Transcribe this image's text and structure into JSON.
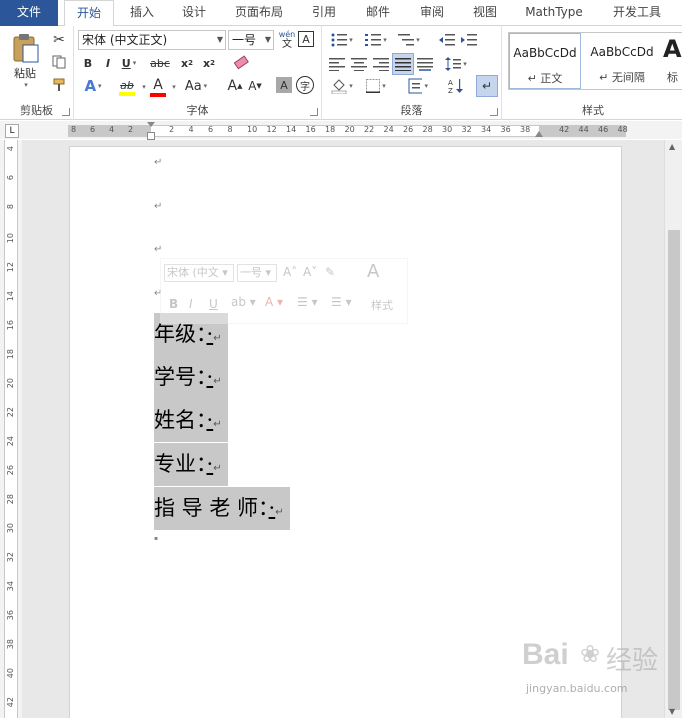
{
  "tabs": [
    {
      "label": "文件",
      "active": false
    },
    {
      "label": "开始",
      "active": true
    },
    {
      "label": "插入",
      "active": false
    },
    {
      "label": "设计",
      "active": false
    },
    {
      "label": "页面布局",
      "active": false
    },
    {
      "label": "引用",
      "active": false
    },
    {
      "label": "邮件",
      "active": false
    },
    {
      "label": "审阅",
      "active": false
    },
    {
      "label": "视图",
      "active": false
    },
    {
      "label": "MathType",
      "active": false
    },
    {
      "label": "开发工具",
      "active": false
    }
  ],
  "clipboard": {
    "label": "剪贴板",
    "paste_label": "粘贴"
  },
  "font": {
    "label": "字体",
    "font_name": "宋体 (中文正文)",
    "font_size": "一号",
    "phonetic_top": "wén",
    "phonetic_bottom": "文",
    "border_char": "A",
    "bold": "B",
    "italic": "I",
    "underline": "U",
    "strike": "abc",
    "subscript": "x",
    "subscript_mark": "2",
    "superscript": "x",
    "superscript_mark": "2",
    "grow": "A",
    "shrink": "A",
    "case": "Aa",
    "shading_char": "A",
    "enclose_char": "字",
    "text_effect": "A",
    "highlight": "ab",
    "font_color": "A"
  },
  "paragraph": {
    "label": "段落"
  },
  "styles": {
    "label": "样式",
    "items": [
      {
        "preview": "AaBbCcDd",
        "name": "正文"
      },
      {
        "preview": "AaBbCcDd",
        "name": "无间隔"
      },
      {
        "preview": "Aa",
        "name": "标"
      }
    ]
  },
  "ruler": {
    "h_ticks_left": [
      "8",
      "6",
      "4",
      "2"
    ],
    "h_ticks_right": [
      "2",
      "4",
      "6",
      "8",
      "10",
      "12",
      "14",
      "16",
      "18",
      "20",
      "22",
      "24",
      "26",
      "28",
      "30",
      "32",
      "34",
      "36",
      "38",
      "42",
      "44",
      "46",
      "48"
    ],
    "v_ticks": [
      "4",
      "6",
      "8",
      "10",
      "12",
      "14",
      "16",
      "18",
      "20",
      "22",
      "24",
      "26",
      "28",
      "30",
      "32",
      "34",
      "36",
      "38",
      "40",
      "42"
    ]
  },
  "document": {
    "lines": [
      {
        "label": "年级：",
        "blank": "·"
      },
      {
        "label": "学号：",
        "blank": "·"
      },
      {
        "label": "姓名：",
        "blank": "·"
      },
      {
        "label": "专业：",
        "blank": "·"
      },
      {
        "label": "指 导 老 师：",
        "blank": "·"
      }
    ],
    "paragraph_mark": "↵"
  },
  "mini_toolbar": {
    "font_name": "宋体 (中文",
    "font_size": "一号",
    "bold": "B",
    "italic": "I",
    "underline": "U",
    "styles_label": "样式"
  },
  "watermark": {
    "brand": "Bai",
    "brand_cn": "经验",
    "url": "jingyan.baidu.com"
  },
  "colors": {
    "file_tab": "#2b579a",
    "highlight": "#ffff00",
    "font_color": "#ff0000",
    "selection": "#c8c8c8"
  }
}
